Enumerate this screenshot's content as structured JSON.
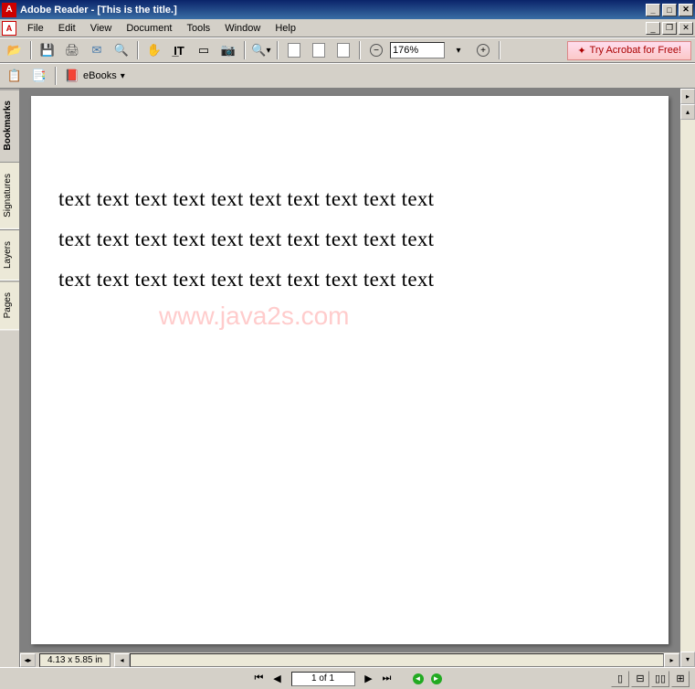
{
  "titlebar": {
    "app_name": "Adobe Reader",
    "doc_title": "[This is the title.]",
    "full_title": "Adobe Reader - [This is the title.]"
  },
  "menubar": {
    "items": [
      "File",
      "Edit",
      "View",
      "Document",
      "Tools",
      "Window",
      "Help"
    ]
  },
  "toolbar1": {
    "zoom_value": "176%",
    "promo_label": "Try Acrobat for Free!"
  },
  "toolbar2": {
    "ebooks_label": "eBooks"
  },
  "sidebar": {
    "tabs": [
      {
        "label": "Bookmarks",
        "active": true
      },
      {
        "label": "Signatures",
        "active": false
      },
      {
        "label": "Layers",
        "active": false
      },
      {
        "label": "Pages",
        "active": false
      }
    ]
  },
  "document": {
    "lines": [
      "text text text text text text text text text text",
      "text text text text text text text text text text",
      "text text text text text text text text text text"
    ],
    "watermark": "www.java2s.com"
  },
  "statusbar": {
    "size_text": "4.13 x 5.85 in",
    "page_text": "1 of 1"
  }
}
